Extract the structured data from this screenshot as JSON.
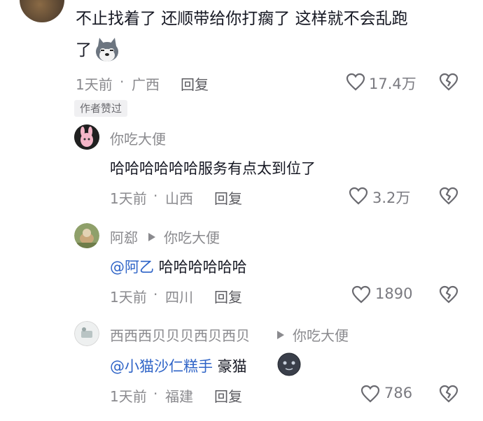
{
  "top_comment": {
    "text_line1": "不止找着了  还顺带给你打瘸了  这样就不会乱跑",
    "text_line2": "了",
    "time": "1天前",
    "location": "广西",
    "reply_label": "回复",
    "likes": "17.4万",
    "author_liked_badge": "作者赞过"
  },
  "replies": [
    {
      "name": "你吃大便",
      "text": "哈哈哈哈哈哈服务有点太到位了",
      "time": "1天前",
      "location": "山西",
      "reply_label": "回复",
      "likes": "3.2万"
    },
    {
      "name": "阿郄",
      "reply_to": "你吃大便",
      "mention": "@阿乙",
      "text": " 哈哈哈哈哈哈",
      "time": "1天前",
      "location": "四川",
      "reply_label": "回复",
      "likes": "1890"
    },
    {
      "name": "西西西贝贝贝西贝西贝",
      "reply_to": "你吃大便",
      "mention": "@小猫沙仁糕手",
      "text": " 豪猫",
      "time": "1天前",
      "location": "福建",
      "reply_label": "回复",
      "likes": "786"
    }
  ],
  "separator": "·",
  "colors": {
    "text": "#161823",
    "meta": "#8a8a8e",
    "mention": "#2f64c7"
  },
  "icons": [
    "heart-icon",
    "broken-heart-icon",
    "triangle-right-icon",
    "husky-emoji",
    "cat-emoji"
  ]
}
